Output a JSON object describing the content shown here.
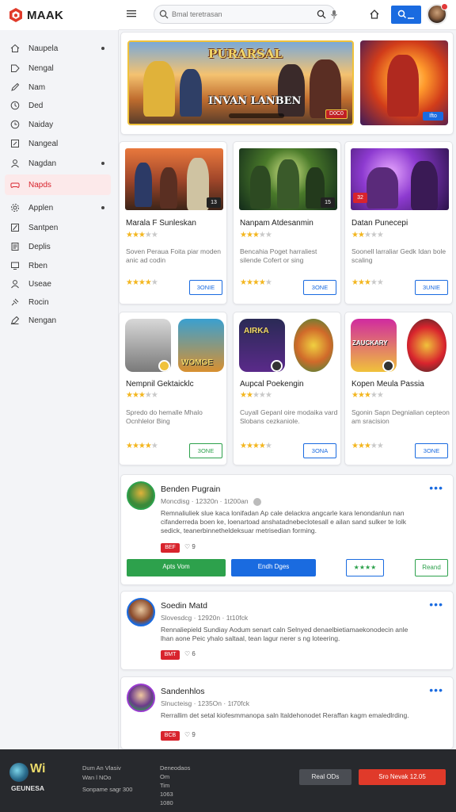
{
  "brand": {
    "name": "MAAK"
  },
  "search": {
    "placeholder": "Bmal teretrasan"
  },
  "sidebar": {
    "items": [
      {
        "label": "Naupela",
        "bullet": true
      },
      {
        "label": "Nengal",
        "bullet": false
      },
      {
        "label": "Nam",
        "bullet": false
      },
      {
        "label": "Ded",
        "bullet": false
      },
      {
        "label": "Naiday",
        "bullet": false
      },
      {
        "label": "Nangeal",
        "bullet": false
      },
      {
        "label": "Nagdan",
        "bullet": true
      },
      {
        "label": "Napds",
        "bullet": false,
        "active": true
      },
      {
        "label": "Applen",
        "bullet": true
      },
      {
        "label": "Santpen",
        "bullet": false
      },
      {
        "label": "Deplis",
        "bullet": false
      },
      {
        "label": "Rben",
        "bullet": false
      },
      {
        "label": "Useae",
        "bullet": false
      },
      {
        "label": "Rocin",
        "bullet": false
      },
      {
        "label": "Nengan",
        "bullet": false
      }
    ]
  },
  "hero": {
    "title": "PURARSAL",
    "subtitle": "INVAN LANBEN",
    "badge": "D0C0",
    "side_badge": "Ifto"
  },
  "games": [
    {
      "title": "Marala F Sunleskan",
      "rating": 3,
      "desc": "Soven Peraua Foita piar moden anic ad codin",
      "rating2": 4,
      "action": "3ONIE",
      "badge": "13",
      "action_style": "blue"
    },
    {
      "title": "Nanpam Atdesanmin",
      "rating": 3,
      "desc": "Bencahia Poget harraliest silende Cofert or sing",
      "rating2": 4,
      "action": "3ONE",
      "badge": "15",
      "action_style": "blue"
    },
    {
      "title": "Datan Punecepi",
      "rating": 2,
      "desc": "Soonell larraliar Gedk Idan bole scaling",
      "rating2": 3,
      "action": "3UNIE",
      "badge": "32",
      "action_style": "blue"
    },
    {
      "title": "Nempnil Gektaicklc",
      "rating": 3,
      "desc": "Spredo do hemalle Mhalo Ocnhlelor Bing",
      "rating2": 4,
      "action": "3ONE",
      "badge": "",
      "action_style": "green",
      "icon_label": "WOMGE"
    },
    {
      "title": "Aupcal Poekengin",
      "rating": 2,
      "desc": "Cuyall Gepanl oire modaika vard Slobans cezkaniole.",
      "rating2": 4,
      "action": "3ONA",
      "badge": "",
      "action_style": "blue",
      "icon_label": "AIRKA"
    },
    {
      "title": "Kopen Meula Passia",
      "rating": 3,
      "desc": "Sgonin Sapn Degnialian cepteon am sracision",
      "rating2": 3,
      "action": "3ONE",
      "badge": "",
      "action_style": "blue",
      "icon_label": "ZAUCKARY"
    }
  ],
  "reviews": [
    {
      "name": "Benden Pugrain",
      "meta": "Moncdisg · 12320n · 1t200an",
      "text": "Remnaliuliek slue kaca lonifadan Ap cale delackra angcarle kara lenondanlun nan cifanderreda boen ke, loenartoad anshatadnebeclotesall e ailan sand sulker te Iolk sedick, teanerbinnetheldeksuar metrisedian forming.",
      "flag": "BEF",
      "likes": "9",
      "actions": [
        "Apts Vom",
        "Endh Dges",
        "★★★★",
        "Reand"
      ]
    },
    {
      "name": "Soedin Matd",
      "meta": "Slovesdcg · 12920n · 1t10fck",
      "text": "Rennaliepield Sundiay Aodum senart caln Selnyed denaelbietiamaekonodecin anle lhan aone Peic yhalo saltaal, tean lagur nerer s ng loteering.",
      "flag": "BMT",
      "likes": "6"
    },
    {
      "name": "Sandenhlos",
      "meta": "Slnucteisg · 1235On · 1t70fck",
      "text": "Rerrallim det setal kiofesmmanopa saln ltaldehonodet Reraffan kagm emaledlrding.",
      "flag": "BCB",
      "likes": "9"
    }
  ],
  "footer": {
    "brand": "Wi",
    "sub": "GEUNESA",
    "col1": [
      "Dum An Vlasiv",
      "Wan l NOo"
    ],
    "col1_extra": "Sonpame sagr 300",
    "col2": [
      "Deneodaos",
      "Om",
      "Tim",
      "1063",
      "1080"
    ],
    "btn_secondary": "Real ODs",
    "btn_primary": "Sro Nevak  12.05"
  },
  "colors": {
    "accent": "#1a6be0",
    "active": "#d8242d",
    "green": "#2da14c",
    "footer_bg": "#27292d"
  }
}
